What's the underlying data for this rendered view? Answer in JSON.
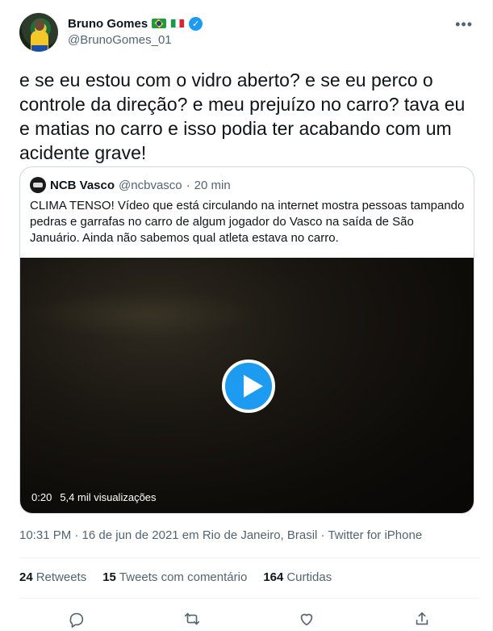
{
  "author": {
    "display_name": "Bruno Gomes",
    "handle": "@BrunoGomes_01",
    "flags": [
      "brazil-flag",
      "italy-flag"
    ],
    "verified": true
  },
  "more_label": "•••",
  "tweet_text": "e se eu estou com o vidro aberto? e se eu perco o controle da direção? e meu prejuízo no carro? tava eu e matias no carro e isso podia ter acabando com um acidente grave!",
  "quote": {
    "name": "NCB Vasco",
    "handle": "@ncbvasco",
    "separator": "·",
    "time": "20 min",
    "text": "CLIMA TENSO! Vídeo que está circulando na internet mostra pessoas tampando pedras e garrafas no carro de algum jogador do Vasco na saída de São Januário. Ainda não sabemos qual atleta estava no carro.",
    "video": {
      "duration": "0:20",
      "views": "5,4 mil visualizações"
    }
  },
  "timestamp": "10:31 PM · 16 de jun de 2021 em Rio de Janeiro, Brasil · Twitter for iPhone",
  "stats": {
    "retweets_count": "24",
    "retweets_label": "Retweets",
    "quotes_count": "15",
    "quotes_label": "Tweets com comentário",
    "likes_count": "164",
    "likes_label": "Curtidas"
  },
  "colors": {
    "accent": "#1d9bf0",
    "text": "#0f1419",
    "secondary": "#536471",
    "border": "#cfd9de"
  }
}
